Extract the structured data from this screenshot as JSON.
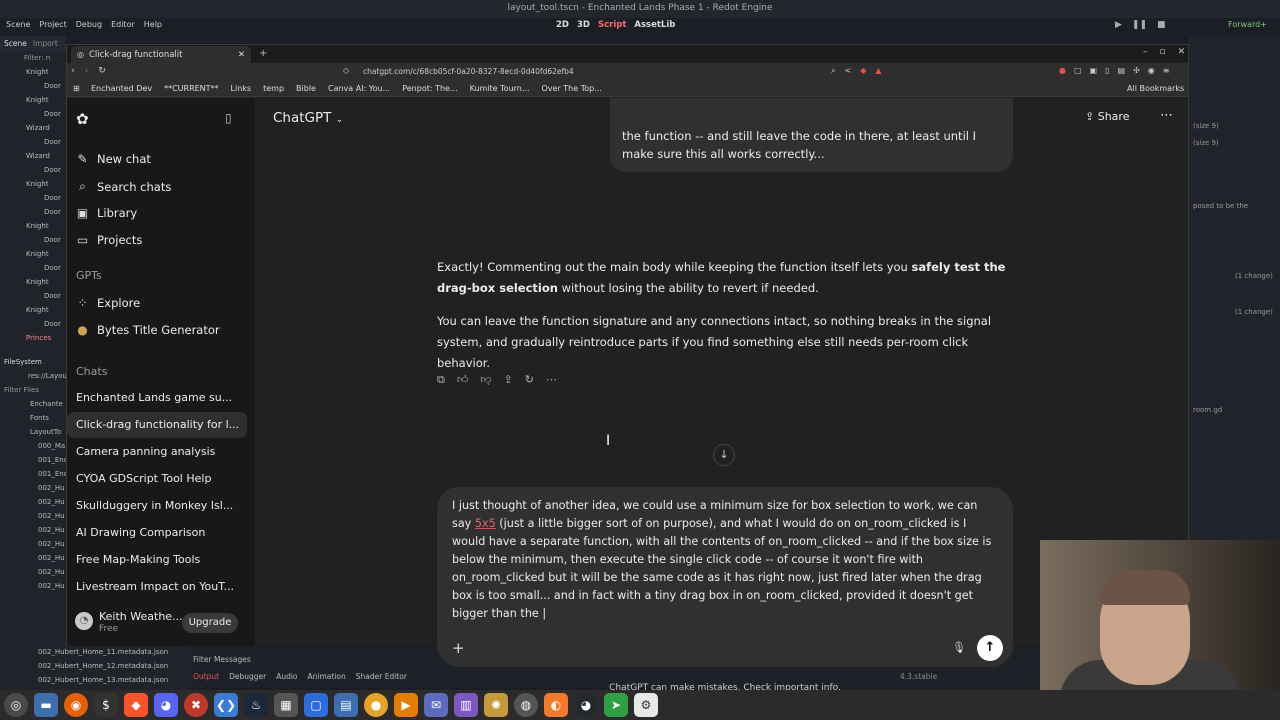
{
  "godot": {
    "window_title": "layout_tool.tscn - Enchanted Lands Phase 1 - Redot Engine",
    "menu": [
      "Scene",
      "Project",
      "Debug",
      "Editor",
      "Help"
    ],
    "modes": [
      "2D",
      "3D",
      "Script",
      "AssetLib"
    ],
    "renderer": "Forward+",
    "left_dock_tabs": [
      "Scene",
      "Import"
    ],
    "scene_filter": "Filter: n",
    "scene_nodes": [
      "Knight",
      "Door",
      "Knight",
      "Door",
      "Wizard",
      "Door",
      "Wizard",
      "Door",
      "Knight",
      "Door",
      "Door",
      "Knight",
      "Door",
      "Knight",
      "Door",
      "Knight",
      "Door",
      "Knight",
      "Door",
      "Princes"
    ],
    "filesystem_title": "FileSystem",
    "fs_path": "res://Layou",
    "fs_filter": "Filter Files",
    "fs_items": [
      "Enchante",
      "Fonts",
      "LayoutTo",
      "000_Ma",
      "001_Enc",
      "001_Enc",
      "002_Hu",
      "002_Hu",
      "002_Hu",
      "002_Hu",
      "002_Hu",
      "002_Hu",
      "002_Hu",
      "002_Hu",
      "002_Hubert_Home_11.metadata.json",
      "002_Hubert_Home_12.metadata.json",
      "002_Hubert_Home_13.metadata.json"
    ],
    "right_dock": [
      "(size 9)",
      "(size 9)",
      "posed to be the",
      "(1 change)",
      "(1 change)",
      "room.gd"
    ],
    "bottom_tabs": [
      "Output",
      "Debugger",
      "Audio",
      "Animation",
      "Shader Editor"
    ],
    "filter_messages": "Filter Messages",
    "version": "4.3.stable"
  },
  "browser": {
    "tab_title": "Click-drag functionalit",
    "url": "chatgpt.com/c/68cb05cf-0a20-8327-8ecd-0d40fd62efb4",
    "bookmarks": [
      "Enchanted Dev",
      "**CURRENT**",
      "Links",
      "temp",
      "Bible",
      "Canva AI: You...",
      "Penpot: The...",
      "Kumite Tourn...",
      "Over The Top..."
    ],
    "all_bookmarks": "All Bookmarks"
  },
  "sidebar": {
    "new_chat": "New chat",
    "search_chats": "Search chats",
    "library": "Library",
    "projects": "Projects",
    "gpts_heading": "GPTs",
    "explore": "Explore",
    "bytes": "Bytes Title Generator",
    "chats_heading": "Chats",
    "chats": [
      "Enchanted Lands game su...",
      "Click-drag functionality for l...",
      "Camera panning analysis",
      "CYOA GDScript Tool Help",
      "Skullduggery in Monkey Isl...",
      "AI Drawing Comparison",
      "Free Map-Making Tools",
      "Livestream Impact on YouT..."
    ],
    "active_chat_index": 1,
    "user_name": "Keith Weathe...",
    "user_plan": "Free",
    "upgrade": "Upgrade"
  },
  "main": {
    "model": "ChatGPT",
    "share": "Share",
    "prev_user_message": "the function -- and still leave the code in there, at least until I make sure this all works correctly...",
    "ai_p1_pre": "Exactly! Commenting out the main body while keeping the function itself lets you ",
    "ai_p1_bold": "safely test the drag-box selection",
    "ai_p1_post": " without losing the ability to revert if needed.",
    "ai_p2": "You can leave the function signature and any connections intact, so nothing breaks in the signal system, and gradually reintroduce parts if you find something else still needs per-room click behavior.",
    "composer_pre": "I just thought of another idea, we could use a minimum size for box selection to work, we can say ",
    "composer_ul": "5x5",
    "composer_post": " (just a little bigger sort of on purpose), and what I would do on on_room_clicked is I would have a separate function, with all the contents of on_room_clicked -- and if the box size is below the minimum, then execute the single click code -- of course it won't fire with on_room_clicked but it will be the same code as it has right now, just fired later when the drag box is too small...  and in fact with a tiny drag box in on_room_clicked, provided it doesn't get bigger than the |",
    "disclaimer": "ChatGPT can make mistakes. Check important info."
  }
}
